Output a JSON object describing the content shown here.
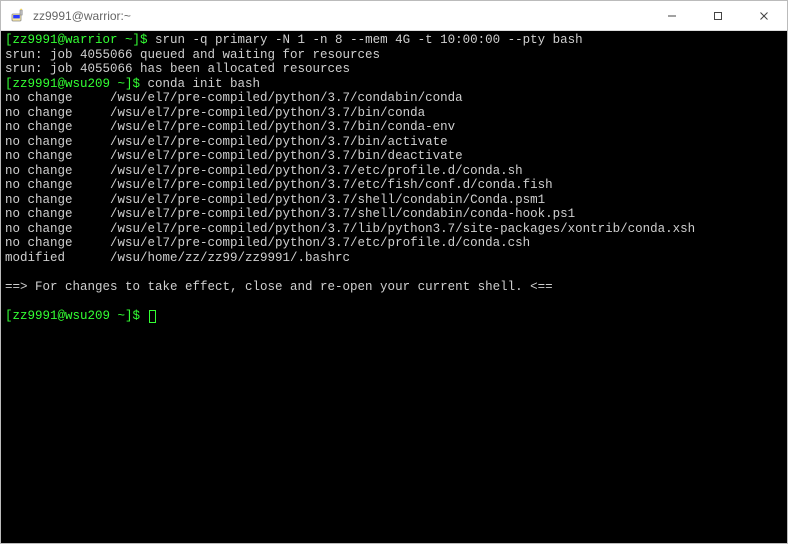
{
  "window": {
    "title": "zz9991@warrior:~"
  },
  "session": {
    "prompt1": "[zz9991@warrior ~]$ ",
    "cmd1": "srun -q primary -N 1 -n 8 --mem 4G -t 10:00:00 --pty bash",
    "queued": "srun: job 4055066 queued and waiting for resources",
    "alloc": "srun: job 4055066 has been allocated resources",
    "prompt2": "[zz9991@wsu209 ~]$ ",
    "cmd2": "conda init bash",
    "lines": [
      "no change     /wsu/el7/pre-compiled/python/3.7/condabin/conda",
      "no change     /wsu/el7/pre-compiled/python/3.7/bin/conda",
      "no change     /wsu/el7/pre-compiled/python/3.7/bin/conda-env",
      "no change     /wsu/el7/pre-compiled/python/3.7/bin/activate",
      "no change     /wsu/el7/pre-compiled/python/3.7/bin/deactivate",
      "no change     /wsu/el7/pre-compiled/python/3.7/etc/profile.d/conda.sh",
      "no change     /wsu/el7/pre-compiled/python/3.7/etc/fish/conf.d/conda.fish",
      "no change     /wsu/el7/pre-compiled/python/3.7/shell/condabin/Conda.psm1",
      "no change     /wsu/el7/pre-compiled/python/3.7/shell/condabin/conda-hook.ps1",
      "no change     /wsu/el7/pre-compiled/python/3.7/lib/python3.7/site-packages/xontrib/conda.xsh",
      "no change     /wsu/el7/pre-compiled/python/3.7/etc/profile.d/conda.csh",
      "modified      /wsu/home/zz/zz99/zz9991/.bashrc"
    ],
    "footer": "==> For changes to take effect, close and re-open your current shell. <==",
    "prompt3": "[zz9991@wsu209 ~]$ "
  }
}
